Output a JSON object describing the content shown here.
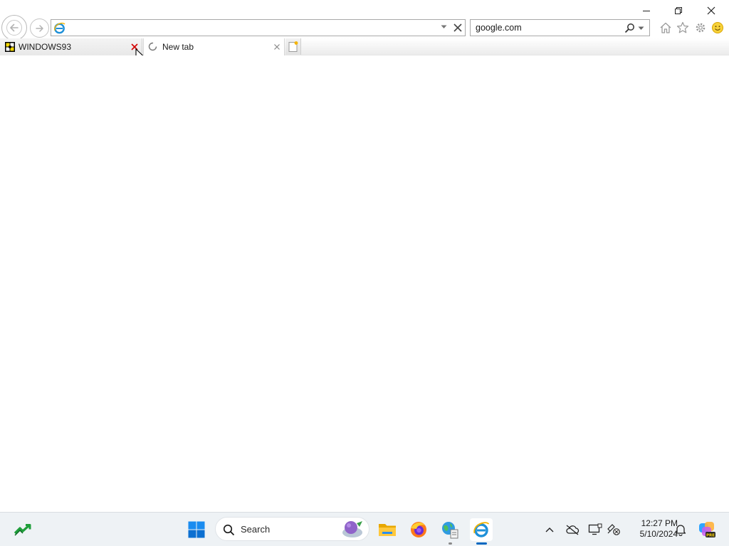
{
  "window": {
    "minimize_icon": "minimize-icon",
    "restore_icon": "restore-icon",
    "close_icon": "close-icon"
  },
  "navigation": {
    "back_icon": "back-arrow-icon",
    "forward_icon": "forward-arrow-icon"
  },
  "address_bar": {
    "value": "",
    "placeholder": "",
    "favicon": "ie-logo-icon"
  },
  "search_bar": {
    "value": "google.com",
    "placeholder": ""
  },
  "toolbar": {
    "icons": [
      "home-icon",
      "favorites-star-icon",
      "tools-gear-icon",
      "feedback-smiley-icon"
    ]
  },
  "tabs": [
    {
      "label": "WINDOWS93",
      "icon": "windows93-favicon-icon",
      "active": false,
      "close_hover": true
    },
    {
      "label": "New tab",
      "icon": "loading-spinner-icon",
      "active": true
    }
  ],
  "taskbar": {
    "search_label": "Search",
    "pinned": [
      "start-button",
      "search",
      "file-explorer",
      "firefox",
      "network-app",
      "internet-explorer"
    ],
    "active_app": "internet-explorer"
  },
  "clock": {
    "time": "12:27 PM",
    "date": "5/10/2024"
  },
  "colors": {
    "accent": "#0067c0",
    "taskbar_bg": "#eef2f5",
    "tab_close_hover": "#d40000"
  }
}
